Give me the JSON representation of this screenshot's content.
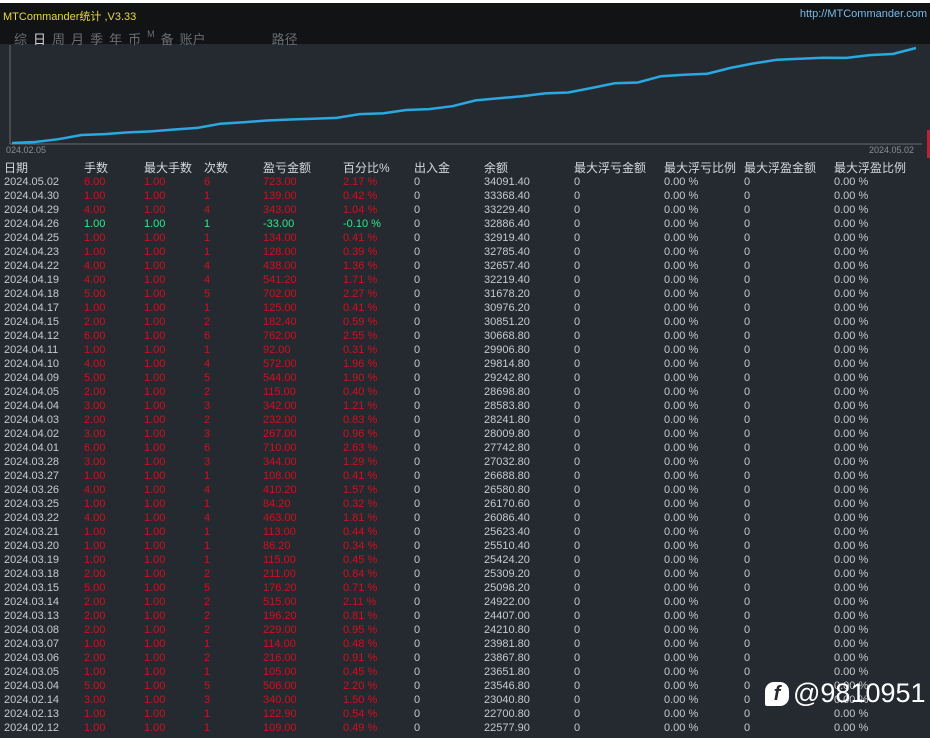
{
  "app": {
    "title": "MTCommander统计 ,V3.33",
    "url": "http://MTCommander.com"
  },
  "tabs": [
    {
      "label": "综",
      "active": false
    },
    {
      "label": "日",
      "active": true
    },
    {
      "label": "周",
      "active": false
    },
    {
      "label": "月",
      "active": false
    },
    {
      "label": "季",
      "active": false
    },
    {
      "label": "年",
      "active": false
    },
    {
      "label": "币",
      "active": false
    },
    {
      "label": "M",
      "active": false
    },
    {
      "label": "备",
      "active": false
    },
    {
      "label": "账户",
      "active": false
    },
    {
      "label": "路径",
      "active": false
    }
  ],
  "chart_data": {
    "type": "line",
    "x_start_label": "024.02.05",
    "x_end_label": "2024.05.02",
    "line_color": "#2aa8e0",
    "series": [
      {
        "values": [
          22577.9,
          22700.8,
          23040.8,
          23546.8,
          23651.8,
          23867.8,
          23981.8,
          24210.8,
          24407.0,
          24922.0,
          25098.2,
          25309.2,
          25424.2,
          25510.4,
          25623.4,
          26086.4,
          26170.6,
          26580.8,
          26688.8,
          27032.8,
          27742.8,
          28009.8,
          28241.8,
          28583.8,
          28698.8,
          29242.8,
          29814.8,
          29906.8,
          30668.8,
          30851.2,
          30976.2,
          31678.2,
          32219.4,
          32657.4,
          32785.4,
          32919.4,
          32886.4,
          33229.4,
          33368.4,
          34091.4
        ]
      }
    ]
  },
  "colors": {
    "profit": "#d0101c",
    "loss": "#2ee88a",
    "text": "#c5cad2"
  },
  "table": {
    "headers": [
      "日期",
      "手数",
      "最大手数",
      "次数",
      "盈亏金额",
      "百分比%",
      "出入金",
      "余额",
      "最大浮亏金额",
      "最大浮亏比例",
      "最大浮盈金额",
      "最大浮盈比例"
    ],
    "rows": [
      [
        "2024.05.02",
        "6.00",
        "1.00",
        "6",
        "723.00",
        "2.17 %",
        "0",
        "34091.40",
        "0",
        "0.00 %",
        "0",
        "0.00 %"
      ],
      [
        "2024.04.30",
        "1.00",
        "1.00",
        "1",
        "139.00",
        "0.42 %",
        "0",
        "33368.40",
        "0",
        "0.00 %",
        "0",
        "0.00 %"
      ],
      [
        "2024.04.29",
        "4.00",
        "1.00",
        "4",
        "343.00",
        "1.04 %",
        "0",
        "33229.40",
        "0",
        "0.00 %",
        "0",
        "0.00 %"
      ],
      [
        "2024.04.26",
        "1.00",
        "1.00",
        "1",
        "-33.00",
        "-0.10 %",
        "0",
        "32886.40",
        "0",
        "0.00 %",
        "0",
        "0.00 %"
      ],
      [
        "2024.04.25",
        "1.00",
        "1.00",
        "1",
        "134.00",
        "0.41 %",
        "0",
        "32919.40",
        "0",
        "0.00 %",
        "0",
        "0.00 %"
      ],
      [
        "2024.04.23",
        "1.00",
        "1.00",
        "1",
        "128.00",
        "0.39 %",
        "0",
        "32785.40",
        "0",
        "0.00 %",
        "0",
        "0.00 %"
      ],
      [
        "2024.04.22",
        "4.00",
        "1.00",
        "4",
        "438.00",
        "1.36 %",
        "0",
        "32657.40",
        "0",
        "0.00 %",
        "0",
        "0.00 %"
      ],
      [
        "2024.04.19",
        "4.00",
        "1.00",
        "4",
        "541.20",
        "1.71 %",
        "0",
        "32219.40",
        "0",
        "0.00 %",
        "0",
        "0.00 %"
      ],
      [
        "2024.04.18",
        "5.00",
        "1.00",
        "5",
        "702.00",
        "2.27 %",
        "0",
        "31678.20",
        "0",
        "0.00 %",
        "0",
        "0.00 %"
      ],
      [
        "2024.04.17",
        "1.00",
        "1.00",
        "1",
        "125.00",
        "0.41 %",
        "0",
        "30976.20",
        "0",
        "0.00 %",
        "0",
        "0.00 %"
      ],
      [
        "2024.04.15",
        "2.00",
        "1.00",
        "2",
        "182.40",
        "0.59 %",
        "0",
        "30851.20",
        "0",
        "0.00 %",
        "0",
        "0.00 %"
      ],
      [
        "2024.04.12",
        "6.00",
        "1.00",
        "6",
        "762.00",
        "2.55 %",
        "0",
        "30668.80",
        "0",
        "0.00 %",
        "0",
        "0.00 %"
      ],
      [
        "2024.04.11",
        "1.00",
        "1.00",
        "1",
        "92.00",
        "0.31 %",
        "0",
        "29906.80",
        "0",
        "0.00 %",
        "0",
        "0.00 %"
      ],
      [
        "2024.04.10",
        "4.00",
        "1.00",
        "4",
        "572.00",
        "1.96 %",
        "0",
        "29814.80",
        "0",
        "0.00 %",
        "0",
        "0.00 %"
      ],
      [
        "2024.04.09",
        "5.00",
        "1.00",
        "5",
        "544.00",
        "1.90 %",
        "0",
        "29242.80",
        "0",
        "0.00 %",
        "0",
        "0.00 %"
      ],
      [
        "2024.04.05",
        "2.00",
        "1.00",
        "2",
        "115.00",
        "0.40 %",
        "0",
        "28698.80",
        "0",
        "0.00 %",
        "0",
        "0.00 %"
      ],
      [
        "2024.04.04",
        "3.00",
        "1.00",
        "3",
        "342.00",
        "1.21 %",
        "0",
        "28583.80",
        "0",
        "0.00 %",
        "0",
        "0.00 %"
      ],
      [
        "2024.04.03",
        "2.00",
        "1.00",
        "2",
        "232.00",
        "0.83 %",
        "0",
        "28241.80",
        "0",
        "0.00 %",
        "0",
        "0.00 %"
      ],
      [
        "2024.04.02",
        "3.00",
        "1.00",
        "3",
        "267.00",
        "0.96 %",
        "0",
        "28009.80",
        "0",
        "0.00 %",
        "0",
        "0.00 %"
      ],
      [
        "2024.04.01",
        "6.00",
        "1.00",
        "6",
        "710.00",
        "2.63 %",
        "0",
        "27742.80",
        "0",
        "0.00 %",
        "0",
        "0.00 %"
      ],
      [
        "2024.03.28",
        "3.00",
        "1.00",
        "3",
        "344.00",
        "1.29 %",
        "0",
        "27032.80",
        "0",
        "0.00 %",
        "0",
        "0.00 %"
      ],
      [
        "2024.03.27",
        "1.00",
        "1.00",
        "1",
        "108.00",
        "0.41 %",
        "0",
        "26688.80",
        "0",
        "0.00 %",
        "0",
        "0.00 %"
      ],
      [
        "2024.03.26",
        "4.00",
        "1.00",
        "4",
        "410.20",
        "1.57 %",
        "0",
        "26580.80",
        "0",
        "0.00 %",
        "0",
        "0.00 %"
      ],
      [
        "2024.03.25",
        "1.00",
        "1.00",
        "1",
        "84.20",
        "0.32 %",
        "0",
        "26170.60",
        "0",
        "0.00 %",
        "0",
        "0.00 %"
      ],
      [
        "2024.03.22",
        "4.00",
        "1.00",
        "4",
        "463.00",
        "1.81 %",
        "0",
        "26086.40",
        "0",
        "0.00 %",
        "0",
        "0.00 %"
      ],
      [
        "2024.03.21",
        "1.00",
        "1.00",
        "1",
        "113.00",
        "0.44 %",
        "0",
        "25623.40",
        "0",
        "0.00 %",
        "0",
        "0.00 %"
      ],
      [
        "2024.03.20",
        "1.00",
        "1.00",
        "1",
        "86.20",
        "0.34 %",
        "0",
        "25510.40",
        "0",
        "0.00 %",
        "0",
        "0.00 %"
      ],
      [
        "2024.03.19",
        "1.00",
        "1.00",
        "1",
        "115.00",
        "0.45 %",
        "0",
        "25424.20",
        "0",
        "0.00 %",
        "0",
        "0.00 %"
      ],
      [
        "2024.03.18",
        "2.00",
        "1.00",
        "2",
        "211.00",
        "0.84 %",
        "0",
        "25309.20",
        "0",
        "0.00 %",
        "0",
        "0.00 %"
      ],
      [
        "2024.03.15",
        "5.00",
        "1.00",
        "5",
        "176.20",
        "0.71 %",
        "0",
        "25098.20",
        "0",
        "0.00 %",
        "0",
        "0.00 %"
      ],
      [
        "2024.03.14",
        "2.00",
        "1.00",
        "2",
        "515.00",
        "2.11 %",
        "0",
        "24922.00",
        "0",
        "0.00 %",
        "0",
        "0.00 %"
      ],
      [
        "2024.03.13",
        "2.00",
        "1.00",
        "2",
        "196.20",
        "0.81 %",
        "0",
        "24407.00",
        "0",
        "0.00 %",
        "0",
        "0.00 %"
      ],
      [
        "2024.03.08",
        "2.00",
        "1.00",
        "2",
        "229.00",
        "0.95 %",
        "0",
        "24210.80",
        "0",
        "0.00 %",
        "0",
        "0.00 %"
      ],
      [
        "2024.03.07",
        "1.00",
        "1.00",
        "1",
        "114.00",
        "0.48 %",
        "0",
        "23981.80",
        "0",
        "0.00 %",
        "0",
        "0.00 %"
      ],
      [
        "2024.03.06",
        "2.00",
        "1.00",
        "2",
        "216.00",
        "0.91 %",
        "0",
        "23867.80",
        "0",
        "0.00 %",
        "0",
        "0.00 %"
      ],
      [
        "2024.03.05",
        "1.00",
        "1.00",
        "1",
        "105.00",
        "0.45 %",
        "0",
        "23651.80",
        "0",
        "0.00 %",
        "0",
        "0.00 %"
      ],
      [
        "2024.03.04",
        "5.00",
        "1.00",
        "5",
        "506.00",
        "2.20 %",
        "0",
        "23546.80",
        "0",
        "0.00 %",
        "0",
        "0.00 %"
      ],
      [
        "2024.02.14",
        "3.00",
        "1.00",
        "3",
        "340.00",
        "1.50 %",
        "0",
        "23040.80",
        "0",
        "0.00 %",
        "0",
        "0.00 %"
      ],
      [
        "2024.02.13",
        "1.00",
        "1.00",
        "1",
        "122.90",
        "0.54 %",
        "0",
        "22700.80",
        "0",
        "0.00 %",
        "0",
        "0.00 %"
      ],
      [
        "2024.02.12",
        "1.00",
        "1.00",
        "1",
        "109.00",
        "0.49 %",
        "0",
        "22577.90",
        "0",
        "0.00 %",
        "0",
        "0.00 %"
      ]
    ]
  },
  "watermark": {
    "text": "@9810951",
    "logo": "f"
  }
}
